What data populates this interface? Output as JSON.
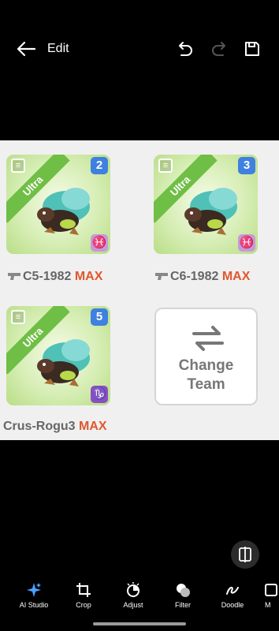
{
  "header": {
    "title": "Edit"
  },
  "cards": [
    {
      "rarity": "Ultra",
      "number": "2",
      "zodiac": "♓",
      "name": "C5-1982",
      "max": "MAX"
    },
    {
      "rarity": "Ultra",
      "number": "3",
      "zodiac": "♓",
      "name": "C6-1982",
      "max": "MAX"
    },
    {
      "rarity": "Ultra",
      "number": "5",
      "zodiac": "♑",
      "name": "Crus-Rogu3",
      "max": "MAX"
    }
  ],
  "change_team": {
    "label": "Change\nTeam"
  },
  "toolbar": {
    "items": [
      {
        "label": "AI Studio",
        "icon": "sparkle-icon"
      },
      {
        "label": "Crop",
        "icon": "crop-icon"
      },
      {
        "label": "Adjust",
        "icon": "adjust-icon"
      },
      {
        "label": "Filter",
        "icon": "filter-icon"
      },
      {
        "label": "Doodle",
        "icon": "doodle-icon"
      },
      {
        "label": "M",
        "icon": "more-icon"
      }
    ]
  },
  "colors": {
    "ai_accent": "#4aa3ff",
    "max": "#e0582d",
    "ribbon": "#6fbe45",
    "number_badge": "#3f80e0"
  }
}
